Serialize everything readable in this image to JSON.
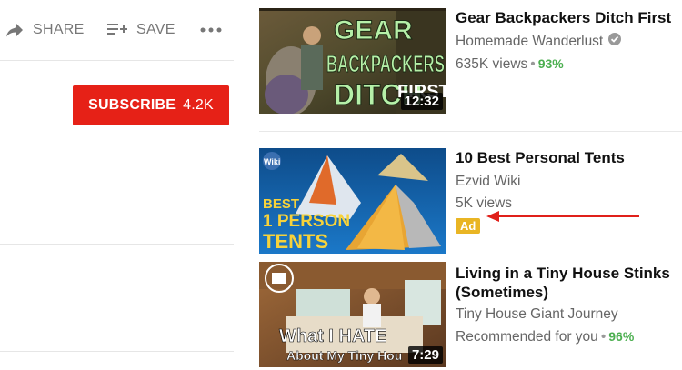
{
  "actions": {
    "share_label": "SHARE",
    "save_label": "SAVE"
  },
  "subscribe": {
    "label": "SUBSCRIBE",
    "count": "4.2K",
    "color": "#e62117"
  },
  "videos": [
    {
      "title": "Gear Backpackers Ditch First",
      "channel": "Homemade Wanderlust",
      "verified": true,
      "views": "635K views",
      "rating": "93%",
      "duration": "12:32",
      "thumb_text": [
        "GEAR",
        "BACKPACKERS",
        "DITCH",
        "FIRST"
      ]
    },
    {
      "title": "10 Best Personal Tents",
      "channel": "Ezvid Wiki",
      "views": "5K views",
      "badge": "Ad",
      "thumb_text": [
        "Wiki",
        "BEST",
        "1 PERSON",
        "TENTS"
      ]
    },
    {
      "title": "Living in a Tiny House Stinks (Sometimes)",
      "channel": "Tiny House Giant Journey",
      "views": "Recommended for you",
      "rating": "96%",
      "duration": "7:29",
      "thumb_text": [
        "What I HATE",
        "About My Tiny Hou"
      ]
    }
  ],
  "colors": {
    "rating_green": "#4caf50",
    "ad_badge": "#e9b524",
    "annotation_arrow": "#e0201a"
  }
}
